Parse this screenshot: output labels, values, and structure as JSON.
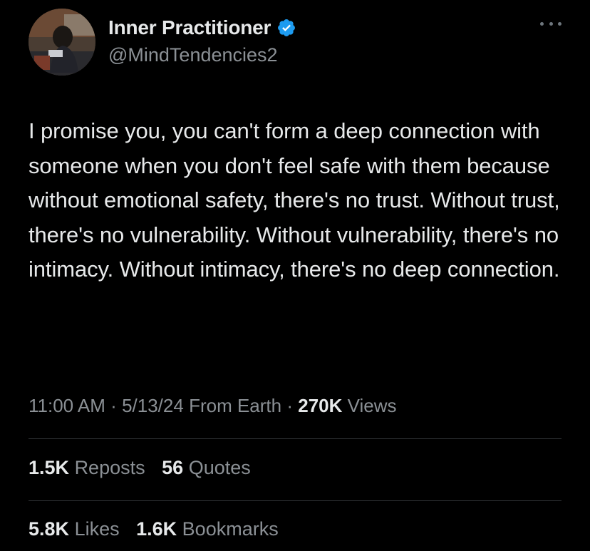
{
  "author": {
    "display_name": "Inner Practitioner",
    "handle": "@MindTendencies2",
    "verified_icon": "verified-badge-icon",
    "avatar": "profile-photo",
    "more_icon": "more-options-icon"
  },
  "tweet": {
    "text": "I promise you, you can't form a deep connection with someone when you don't feel safe with them because without emotional safety, there's no trust. Without trust, there's no vulnerability. Without vulnerability, there's no intimacy. Without intimacy, there's no deep connection."
  },
  "meta": {
    "time": "11:00 AM",
    "separator": "·",
    "date": "5/13/24",
    "source": "From Earth",
    "views_count": "270K",
    "views_label": "Views"
  },
  "stats": {
    "reposts_count": "1.5K",
    "reposts_label": "Reposts",
    "quotes_count": "56",
    "quotes_label": "Quotes",
    "likes_count": "5.8K",
    "likes_label": "Likes",
    "bookmarks_count": "1.6K",
    "bookmarks_label": "Bookmarks"
  },
  "colors": {
    "background": "#000000",
    "primary_text": "#e7e9ea",
    "secondary_text": "#8b9095",
    "verified": "#1d9bf0",
    "divider": "#2f3336"
  }
}
